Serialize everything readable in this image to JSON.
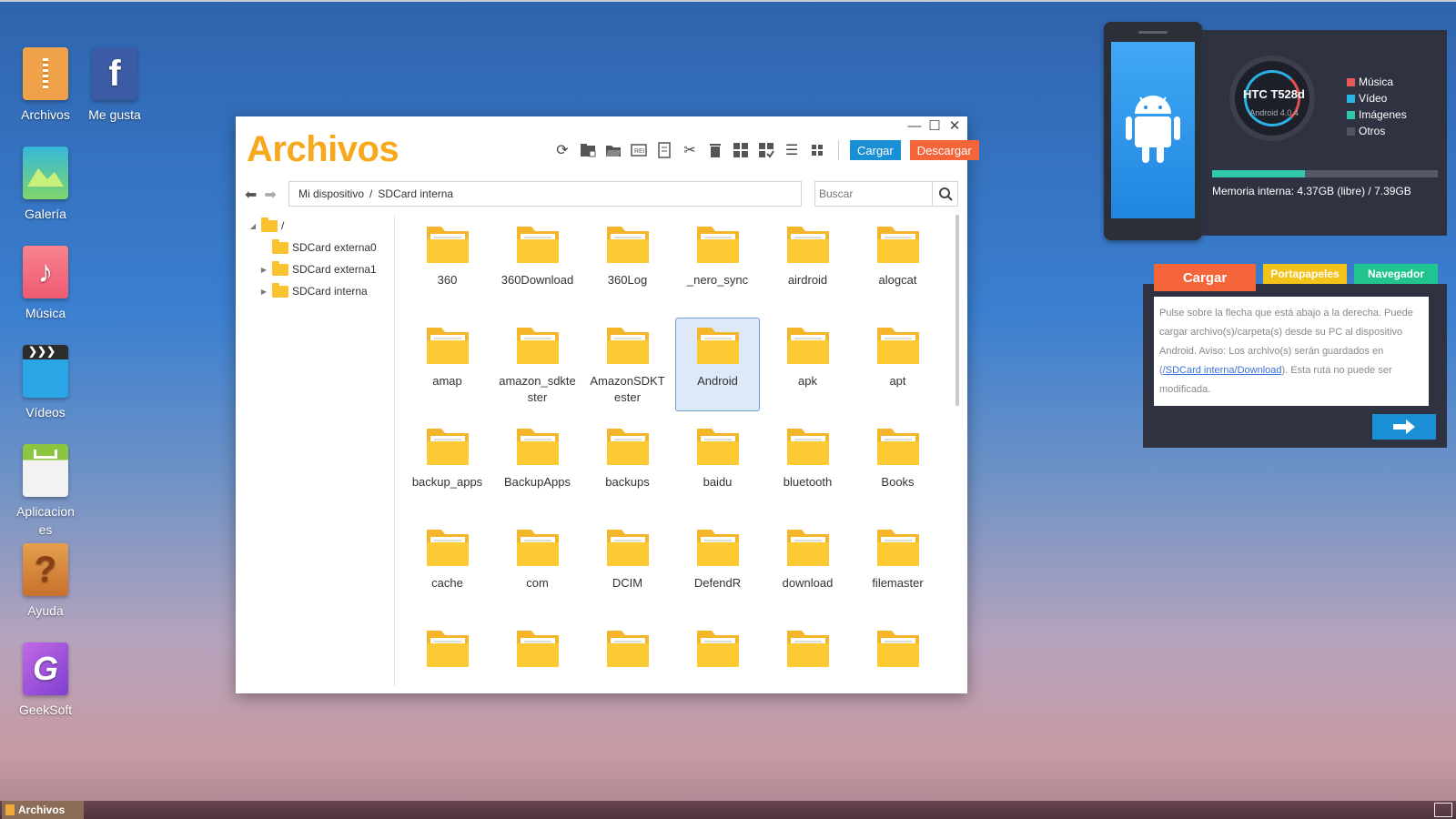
{
  "desktop": {
    "icons": [
      {
        "label": "Archivos",
        "icon": "folder-zip-icon",
        "color": "#f0a24a"
      },
      {
        "label": "Me gusta",
        "icon": "facebook-icon",
        "color": "#3b5ba5"
      },
      {
        "label": "Galería",
        "icon": "gallery-icon",
        "color": "#35b8d9"
      },
      {
        "label": "Música",
        "icon": "music-note-icon",
        "color": "#f46a7a"
      },
      {
        "label": "Vídeos",
        "icon": "clapperboard-icon",
        "color": "#2aa6e6"
      },
      {
        "label": "Aplicaciones",
        "icon": "app-store-icon",
        "color": "#8cc63f"
      },
      {
        "label": "Ayuda",
        "icon": "help-question-icon",
        "color": "#d8873b"
      },
      {
        "label": "GeekSoft",
        "icon": "geeksoft-logo-icon",
        "color": "#a45ad8"
      }
    ]
  },
  "window": {
    "title": "Archivos",
    "toolbar": {
      "upload_label": "Cargar",
      "download_label": "Descargar"
    },
    "breadcrumb": {
      "root": "Mi dispositivo",
      "separator": "/",
      "current": "SDCard interna"
    },
    "search": {
      "placeholder": "Buscar"
    },
    "tree": {
      "root": "/",
      "children": [
        "SDCard externa0",
        "SDCard externa1",
        "SDCard interna"
      ]
    },
    "folders": [
      "360",
      "360Download",
      "360Log",
      "_nero_sync",
      "airdroid",
      "alogcat",
      "amap",
      "amazon_sdktester",
      "AmazonSDKTester",
      "Android",
      "apk",
      "apt",
      "backup_apps",
      "BackupApps",
      "backups",
      "baidu",
      "bluetooth",
      "Books",
      "cache",
      "com",
      "DCIM",
      "DefendR",
      "download",
      "filemaster",
      "",
      "",
      "",
      "",
      "",
      ""
    ],
    "selected_folder": "Android"
  },
  "device": {
    "name": "HTC T528d",
    "os": "Android 4.0.4",
    "legend": [
      {
        "label": "Música",
        "color": "#e85a5a"
      },
      {
        "label": "Vídeo",
        "color": "#2ab1e6"
      },
      {
        "label": "Imágenes",
        "color": "#2fc8a8"
      },
      {
        "label": "Otros",
        "color": "#50545f"
      }
    ],
    "memory_text": "Memoria interna: 4.37GB (libre) / 7.39GB",
    "memory_used_fraction": 0.41
  },
  "upload_panel": {
    "tabs": [
      "Cargar",
      "Portapapeles",
      "Navegador"
    ],
    "text_before": "Pulse sobre la flecha que está abajo a la derecha. Puede cargar archivo(s)/carpeta(s) desde su PC al dispositivo Android. Aviso: Los archivo(s) serán guardados en (",
    "link": "/SDCard interna/Download",
    "text_after": "). Esta ruta no puede ser modificada."
  },
  "taskbar": {
    "active_item": "Archivos"
  }
}
